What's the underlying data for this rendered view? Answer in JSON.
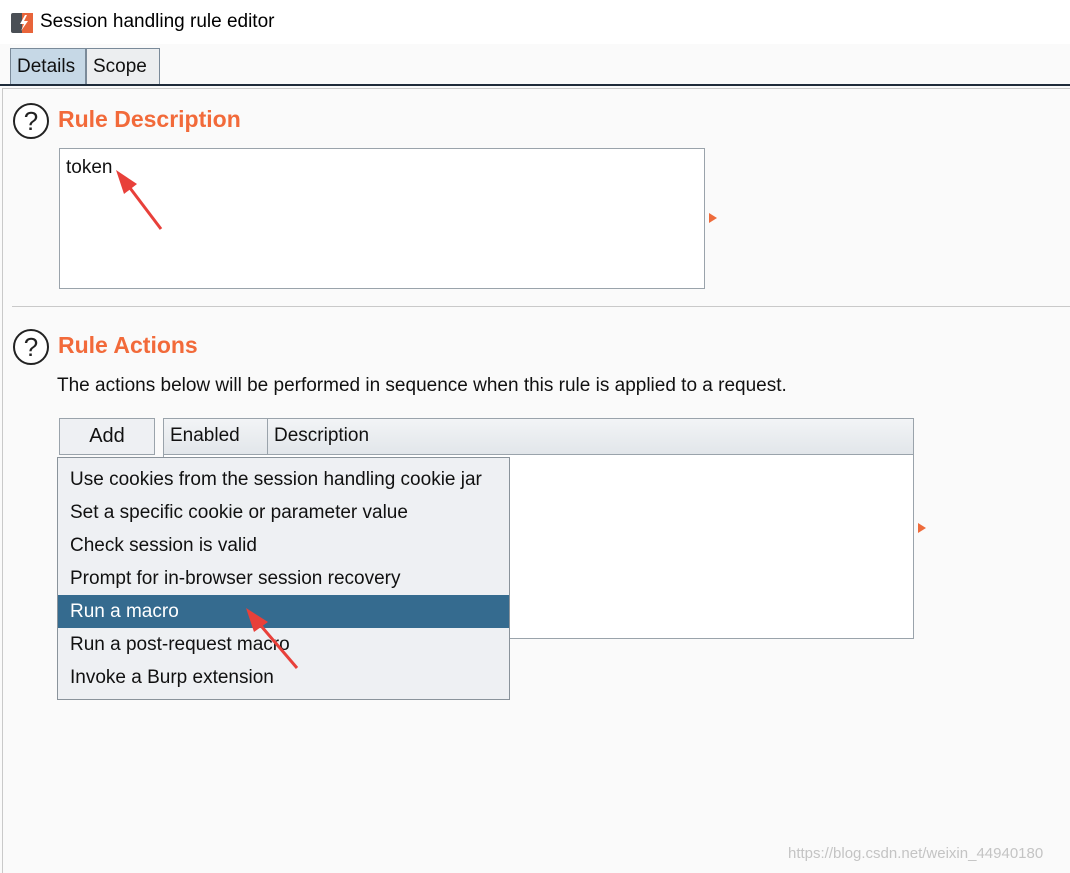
{
  "window": {
    "title": "Session handling rule editor",
    "icon": "burp-app-icon"
  },
  "tabs": [
    {
      "label": "Details",
      "active": true
    },
    {
      "label": "Scope",
      "active": false
    }
  ],
  "rule_description": {
    "help_glyph": "?",
    "title": "Rule Description",
    "value": "token"
  },
  "rule_actions": {
    "help_glyph": "?",
    "title": "Rule Actions",
    "caption": "The actions below will be performed in sequence when this rule is applied to a request.",
    "add_label": "Add",
    "columns": [
      "Enabled",
      "Description"
    ],
    "menu_items": [
      {
        "label": "Use cookies from the session handling cookie jar",
        "selected": false
      },
      {
        "label": "Set a specific cookie or parameter value",
        "selected": false
      },
      {
        "label": "Check session is valid",
        "selected": false
      },
      {
        "label": "Prompt for in-browser session recovery",
        "selected": false
      },
      {
        "label": "Run a macro",
        "selected": true
      },
      {
        "label": "Run a post-request macro",
        "selected": false
      },
      {
        "label": "Invoke a Burp extension",
        "selected": false
      }
    ]
  },
  "watermark": "https://blog.csdn.net/weixin_44940180",
  "colors": {
    "accent": "#f26a3a",
    "selection": "#356b8f",
    "annotation_arrow": "#e8403a"
  }
}
